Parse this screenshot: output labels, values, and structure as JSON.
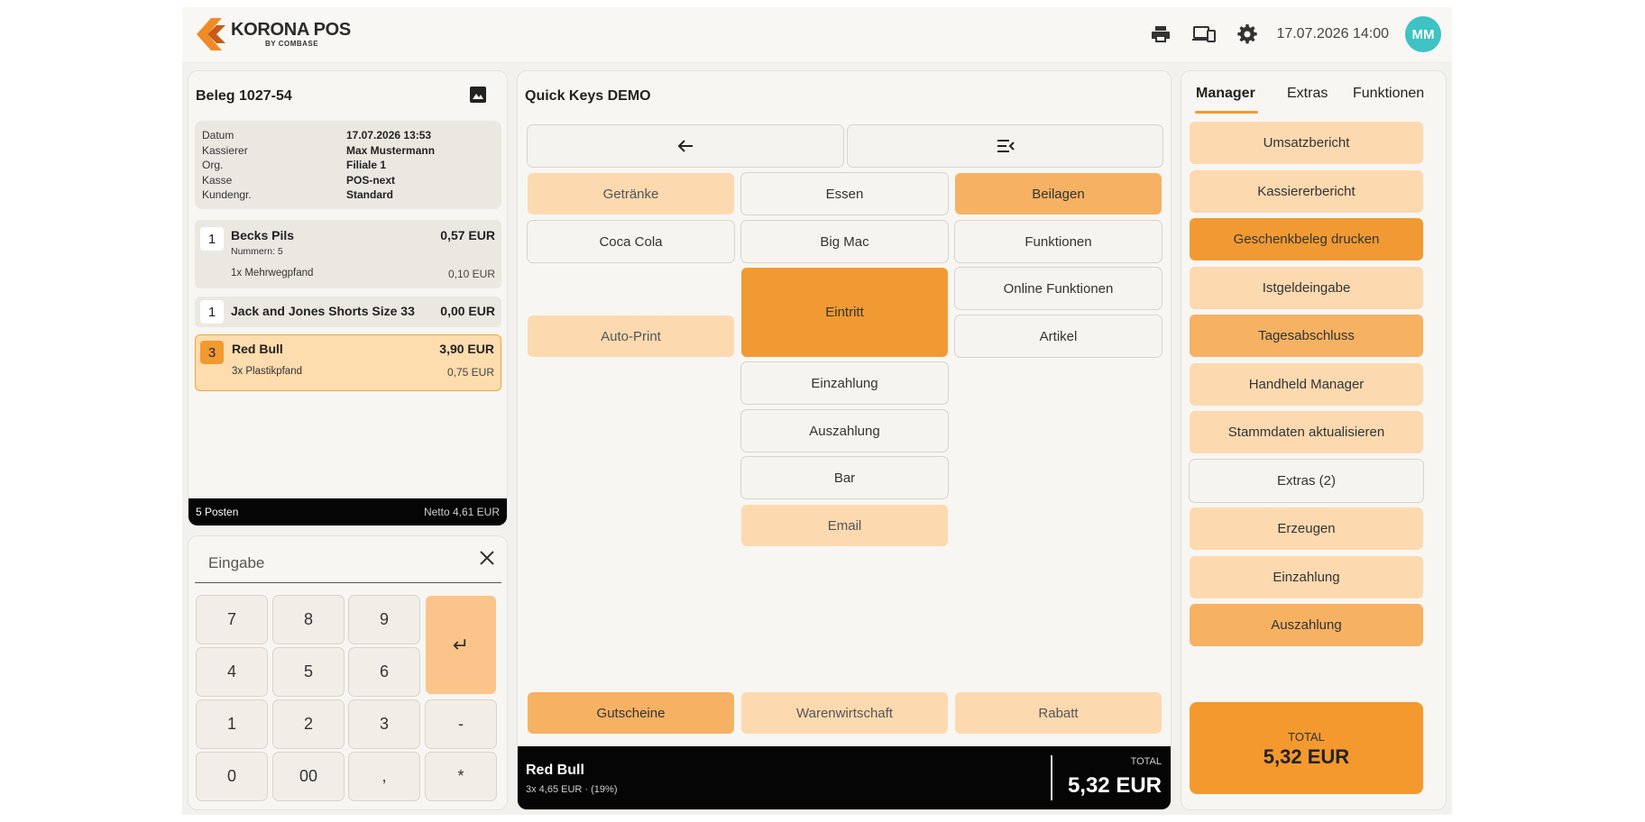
{
  "header": {
    "logo_title": "KORONA POS",
    "logo_subtitle": "BY COMBASE",
    "datetime": "17.07.2026 14:00",
    "avatar_initials": "MM",
    "icons": [
      "printer-icon",
      "devices-icon",
      "gear-icon"
    ]
  },
  "receipt": {
    "title": "Beleg 1027-54",
    "meta": [
      {
        "key": "Datum",
        "value": "17.07.2026 13:53"
      },
      {
        "key": "Kassierer",
        "value": "Max Mustermann"
      },
      {
        "key": "Org.",
        "value": "Filiale 1"
      },
      {
        "key": "Kasse",
        "value": "POS-next"
      },
      {
        "key": "Kundengr.",
        "value": "Standard"
      }
    ],
    "items": [
      {
        "qty": "1",
        "name": "Becks Pils",
        "price": "0,57 EUR",
        "note": "Nummern: 5",
        "sub": "1x Mehrwegpfand",
        "sub_price": "0,10 EUR"
      },
      {
        "qty": "1",
        "name": "Jack and Jones Shorts Size 33",
        "price": "0,00 EUR"
      },
      {
        "qty": "3",
        "name": "Red Bull",
        "price": "3,90 EUR",
        "sub": "3x Plastikpfand",
        "sub_price": "0,75 EUR"
      }
    ],
    "footer_count": "5 Posten",
    "footer_netto": "Netto 4,61 EUR"
  },
  "keypad": {
    "placeholder": "Eingabe",
    "keys": [
      "7",
      "8",
      "9",
      "4",
      "5",
      "6",
      "1",
      "2",
      "3",
      "-",
      "0",
      "00",
      ",",
      "*"
    ],
    "enter_symbol": "↵"
  },
  "quick_keys": {
    "title": "Quick Keys DEMO",
    "buttons": {
      "getraenke": "Getränke",
      "essen": "Essen",
      "beilagen": "Beilagen",
      "coca_cola": "Coca Cola",
      "big_mac": "Big Mac",
      "funktionen": "Funktionen",
      "online_funktionen": "Online Funktionen",
      "eintritt": "Eintritt",
      "auto_print": "Auto-Print",
      "artikel": "Artikel",
      "einzahlung": "Einzahlung",
      "auszahlung": "Auszahlung",
      "bar": "Bar",
      "email": "Email",
      "gutscheine": "Gutscheine",
      "warenwirtschaft": "Warenwirtschaft",
      "rabatt": "Rabatt"
    },
    "status": {
      "name": "Red Bull",
      "detail": "3x 4,65 EUR · (19%)",
      "total_label": "TOTAL",
      "total": "5,32 EUR"
    }
  },
  "right": {
    "tabs": [
      "Manager",
      "Extras",
      "Funktionen"
    ],
    "buttons": [
      "Umsatzbericht",
      "Kassiererbericht",
      "Geschenkbeleg drucken",
      "Istgeldeingabe",
      "Tagesabschluss",
      "Handheld Manager",
      "Stammdaten aktualisieren",
      "Extras (2)",
      "Erzeugen",
      "Einzahlung",
      "Auszahlung"
    ],
    "total_label": "TOTAL",
    "total": "5,32 EUR"
  },
  "colors": {
    "accent": "#f19a33",
    "accent_light": "#fdd9b0",
    "accent_mid": "#f6b163",
    "avatar": "#3fc2c4"
  }
}
